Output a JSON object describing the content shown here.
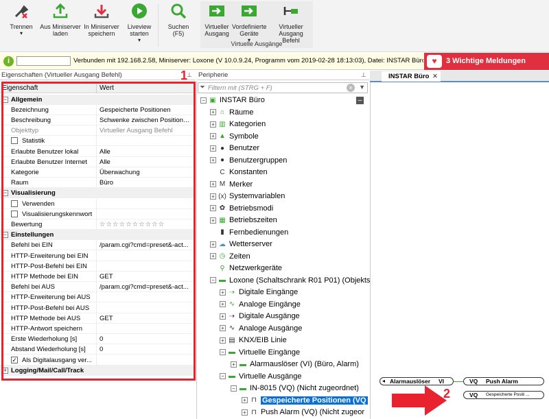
{
  "toolbar": {
    "disconnect": "Trennen",
    "load": "Aus Miniserver laden",
    "save": "In Miniserver speichern",
    "liveview": "Liveview starten",
    "search": "Suchen (F5)",
    "virtual_output": "Virtueller Ausgang",
    "predefined": "Vordefinierte Geräte",
    "virtual_cmd": "Virtueller Ausgang Befehl",
    "group_label": "Virtuelle Ausgänge",
    "colors": {
      "accent": "#0a6fd6",
      "green": "#3aa832",
      "alert": "#e03040"
    }
  },
  "status": {
    "text": "Verbunden mit 192.168.2.58, Miniserver: Loxone (V 10.0.9.24, Programm vom 2019-02-28 18:13:03), Datei: INSTAR Büro.Loxo...",
    "alert": "3 Wichtige Meldungen"
  },
  "properties": {
    "title": "Eigenschaften (Virtueller Ausgang Befehl)",
    "col_prop": "Eigenschaft",
    "col_val": "Wert",
    "rows": [
      {
        "n": "Allgemein",
        "v": ""
      },
      {
        "n": "Bezeichnung",
        "v": "Gespeicherte Positionen"
      },
      {
        "n": "Beschreibung",
        "v": "Schwenke zwischen Position 1..."
      },
      {
        "n": "Objekttyp",
        "v": "Virtueller Ausgang Befehl"
      },
      {
        "n": "Statistik",
        "v": ""
      },
      {
        "n": "Erlaubte Benutzer lokal",
        "v": "Alle"
      },
      {
        "n": "Erlaubte Benutzer Internet",
        "v": "Alle"
      },
      {
        "n": "Kategorie",
        "v": "Überwachung"
      },
      {
        "n": "Raum",
        "v": "Büro"
      },
      {
        "n": "Visualisierung",
        "v": ""
      },
      {
        "n": "Verwenden",
        "v": ""
      },
      {
        "n": "Visualisierungskennwort",
        "v": ""
      },
      {
        "n": "Bewertung",
        "v": "☆☆☆☆☆☆☆☆☆☆"
      },
      {
        "n": "Einstellungen",
        "v": ""
      },
      {
        "n": "Befehl bei EIN",
        "v": "/param.cgi?cmd=preset&-act..."
      },
      {
        "n": "HTTP-Erweiterung bei EIN",
        "v": ""
      },
      {
        "n": "HTTP-Post-Befehl bei EIN",
        "v": ""
      },
      {
        "n": "HTTP Methode bei EIN",
        "v": "GET"
      },
      {
        "n": "Befehl bei AUS",
        "v": "/param.cgi?cmd=preset&-act..."
      },
      {
        "n": "HTTP-Erweiterung bei AUS",
        "v": ""
      },
      {
        "n": "HTTP-Post-Befehl bei AUS",
        "v": ""
      },
      {
        "n": "HTTP Methode bei AUS",
        "v": "GET"
      },
      {
        "n": "HTTP-Antwort speichern",
        "v": ""
      },
      {
        "n": "Erste Wiederholung [s]",
        "v": "0"
      },
      {
        "n": "Abstand Wiederholung [s]",
        "v": "0"
      },
      {
        "n": "Als Digitalausgang ver...",
        "v": ""
      },
      {
        "n": "Logging/Mail/Call/Track",
        "v": ""
      }
    ]
  },
  "periphery": {
    "title": "Peripherie",
    "filter_placeholder": "Filtern mit (STRG + F)",
    "tree": [
      "INSTAR Büro",
      "Räume",
      "Kategorien",
      "Symbole",
      "Benutzer",
      "Benutzergruppen",
      "Konstanten",
      "Merker",
      "Systemvariablen",
      "Betriebsmodi",
      "Betriebszeiten",
      "Fernbedienungen",
      "Wetterserver",
      "Zeiten",
      "Netzwerkgeräte",
      "Loxone (Schaltschrank R01 P01) (Objekts",
      "Digitale Eingänge",
      "Analoge Eingänge",
      "Digitale Ausgänge",
      "Analoge Ausgänge",
      "KNX/EIB Linie",
      "Virtuelle Eingänge",
      "Alarmauslöser (VI) (Büro, Alarm)",
      "Virtuelle Ausgänge",
      "IN-8015 (VQ) (Nicht zugeordnet)",
      "Gespeicherte Positionen (VQ",
      "Push Alarm (VQ) (Nicht zugeor"
    ]
  },
  "document": {
    "tab": "INSTAR Büro",
    "block1": {
      "a": "Alarmauslöser",
      "b": "VI",
      "c": "VQ",
      "d": "Push Alarm"
    },
    "block2": {
      "c": "VQ",
      "d": "Gespeicherte Positi ..."
    }
  },
  "annotations": {
    "one": "1",
    "two": "2"
  }
}
